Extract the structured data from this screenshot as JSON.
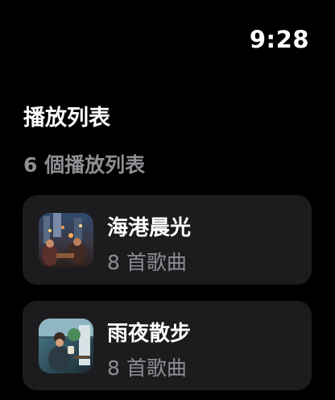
{
  "status": {
    "time": "9:28"
  },
  "header": {
    "title": "播放列表"
  },
  "summary": {
    "count_label": "6 個播放列表"
  },
  "playlists": [
    {
      "title": "海港晨光",
      "subtitle": "8 首歌曲",
      "artwork": "playlist-artwork-icon"
    },
    {
      "title": "雨夜散步",
      "subtitle": "8 首歌曲",
      "artwork": "playlist-artwork-icon"
    }
  ]
}
